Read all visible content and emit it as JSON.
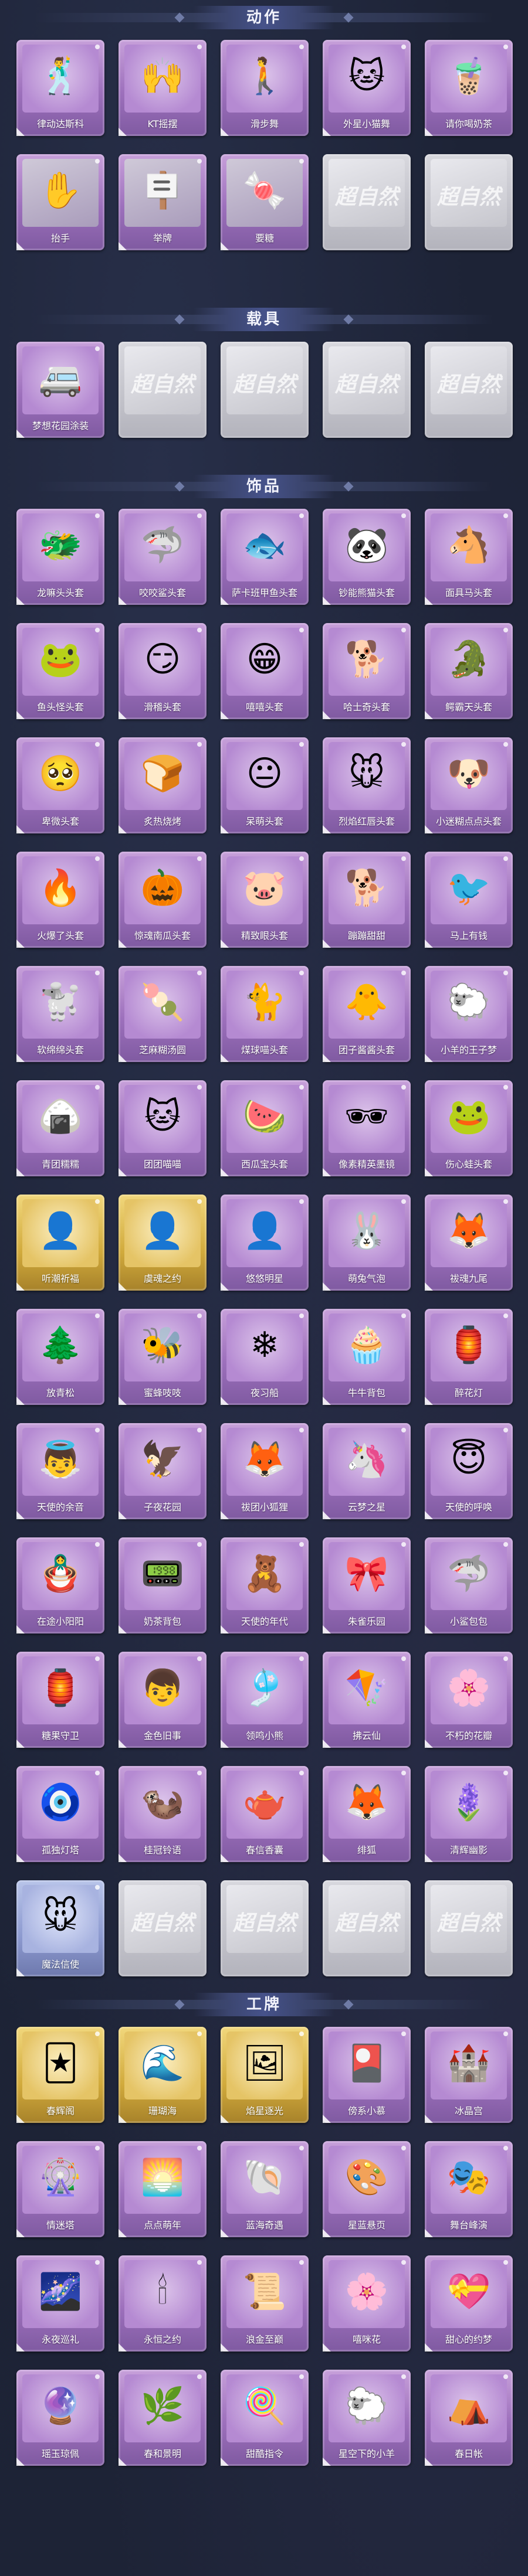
{
  "sections": [
    {
      "key": "actions",
      "title": "动作",
      "cards": [
        {
          "name": "律动达斯科",
          "icon": "🕺",
          "style": "purple"
        },
        {
          "name": "KT摇摆",
          "icon": "🙌",
          "style": "purple"
        },
        {
          "name": "滑步舞",
          "icon": "🚶",
          "style": "purple"
        },
        {
          "name": "外星小猫舞",
          "icon": "🐱",
          "style": "purple"
        },
        {
          "name": "请你喝奶茶",
          "icon": "🧋",
          "style": "purple"
        },
        {
          "name": "抬手",
          "icon": "✋",
          "style": "locked"
        },
        {
          "name": "举牌",
          "icon": "🪧",
          "style": "locked"
        },
        {
          "name": "要糖",
          "icon": "🍬",
          "style": "locked"
        },
        {
          "name": "",
          "icon": "",
          "style": "empty",
          "watermark": "超自然"
        },
        {
          "name": "",
          "icon": "",
          "style": "empty",
          "watermark": "超自然"
        }
      ]
    },
    {
      "key": "vehicles",
      "title": "载具",
      "cards": [
        {
          "name": "梦想花园涂装",
          "icon": "🚐",
          "style": "purple"
        },
        {
          "name": "",
          "icon": "",
          "style": "empty",
          "watermark": "超自然"
        },
        {
          "name": "",
          "icon": "",
          "style": "empty",
          "watermark": "超自然"
        },
        {
          "name": "",
          "icon": "",
          "style": "empty",
          "watermark": "超自然"
        },
        {
          "name": "",
          "icon": "",
          "style": "empty",
          "watermark": "超自然"
        }
      ]
    },
    {
      "key": "accessories",
      "title": "饰品",
      "cards": [
        {
          "name": "龙嘛头头套",
          "icon": "🐲",
          "style": "purple"
        },
        {
          "name": "咬咬鲨头套",
          "icon": "🦈",
          "style": "purple"
        },
        {
          "name": "萨卡班甲鱼头套",
          "icon": "🐟",
          "style": "purple"
        },
        {
          "name": "钞能熊猫头套",
          "icon": "🐼",
          "style": "purple"
        },
        {
          "name": "面具马头套",
          "icon": "🐴",
          "style": "purple"
        },
        {
          "name": "鱼头怪头套",
          "icon": "🐸",
          "style": "purple"
        },
        {
          "name": "滑稽头套",
          "icon": "😏",
          "style": "purple"
        },
        {
          "name": "嘻嘻头套",
          "icon": "😁",
          "style": "purple"
        },
        {
          "name": "哈士奇头套",
          "icon": "🐕",
          "style": "purple"
        },
        {
          "name": "鳄霸天头套",
          "icon": "🐊",
          "style": "purple"
        },
        {
          "name": "卑微头套",
          "icon": "🥺",
          "style": "purple"
        },
        {
          "name": "炙热烧烤",
          "icon": "🍞",
          "style": "purple"
        },
        {
          "name": "呆萌头套",
          "icon": "😐",
          "style": "purple"
        },
        {
          "name": "烈焰红唇头套",
          "icon": "🐭",
          "style": "purple"
        },
        {
          "name": "小迷糊点点头套",
          "icon": "🐶",
          "style": "purple"
        },
        {
          "name": "火爆了头套",
          "icon": "🔥",
          "style": "purple"
        },
        {
          "name": "惊魂南瓜头套",
          "icon": "🎃",
          "style": "purple"
        },
        {
          "name": "精致眼头套",
          "icon": "🐷",
          "style": "purple"
        },
        {
          "name": "蹦蹦甜甜",
          "icon": "🐕",
          "style": "purple"
        },
        {
          "name": "马上有钱",
          "icon": "🐦",
          "style": "purple"
        },
        {
          "name": "软绵绵头套",
          "icon": "🐩",
          "style": "purple"
        },
        {
          "name": "芝麻糊汤圆",
          "icon": "🍡",
          "style": "purple"
        },
        {
          "name": "煤球喵头套",
          "icon": "🐈",
          "style": "purple"
        },
        {
          "name": "团子酱酱头套",
          "icon": "🐥",
          "style": "purple"
        },
        {
          "name": "小羊的王子梦",
          "icon": "🐑",
          "style": "purple"
        },
        {
          "name": "青团糯糯",
          "icon": "🍙",
          "style": "purple"
        },
        {
          "name": "团团喵喵",
          "icon": "🐱",
          "style": "purple"
        },
        {
          "name": "西瓜宝头套",
          "icon": "🍉",
          "style": "purple"
        },
        {
          "name": "像素精英墨镜",
          "icon": "🕶",
          "style": "purple"
        },
        {
          "name": "伤心蛙头套",
          "icon": "🐸",
          "style": "purple"
        },
        {
          "name": "听潮祈福",
          "icon": "👤",
          "style": "gold"
        },
        {
          "name": "虞魂之约",
          "icon": "👤",
          "style": "gold"
        },
        {
          "name": "悠悠明星",
          "icon": "👤",
          "style": "purple"
        },
        {
          "name": "萌兔气泡",
          "icon": "🐰",
          "style": "purple"
        },
        {
          "name": "祓魂九尾",
          "icon": "🦊",
          "style": "purple"
        },
        {
          "name": "放青松",
          "icon": "🌲",
          "style": "purple"
        },
        {
          "name": "蜜蜂吱吱",
          "icon": "🐝",
          "style": "purple"
        },
        {
          "name": "夜习船",
          "icon": "❄",
          "style": "purple"
        },
        {
          "name": "牛牛背包",
          "icon": "🧁",
          "style": "purple"
        },
        {
          "name": "醉花灯",
          "icon": "🏮",
          "style": "purple"
        },
        {
          "name": "天使的余音",
          "icon": "👼",
          "style": "purple"
        },
        {
          "name": "子夜花园",
          "icon": "🦅",
          "style": "purple"
        },
        {
          "name": "祓团小狐狸",
          "icon": "🦊",
          "style": "purple"
        },
        {
          "name": "云梦之星",
          "icon": "🦄",
          "style": "purple"
        },
        {
          "name": "天使的呼唤",
          "icon": "😇",
          "style": "purple"
        },
        {
          "name": "在途小阳阳",
          "icon": "🪆",
          "style": "purple"
        },
        {
          "name": "奶茶背包",
          "icon": "📟",
          "style": "purple"
        },
        {
          "name": "天使的年代",
          "icon": "🧸",
          "style": "purple"
        },
        {
          "name": "朱雀乐园",
          "icon": "🎀",
          "style": "purple"
        },
        {
          "name": "小鲨包包",
          "icon": "🦈",
          "style": "purple"
        },
        {
          "name": "糖果守卫",
          "icon": "🏮",
          "style": "purple"
        },
        {
          "name": "金色旧事",
          "icon": "👦",
          "style": "purple"
        },
        {
          "name": "领鸣小熊",
          "icon": "🎐",
          "style": "purple"
        },
        {
          "name": "拂云仙",
          "icon": "🪁",
          "style": "purple"
        },
        {
          "name": "不朽的花瓣",
          "icon": "🌸",
          "style": "purple"
        },
        {
          "name": "孤独灯塔",
          "icon": "🧿",
          "style": "purple"
        },
        {
          "name": "桂冠铃语",
          "icon": "🦦",
          "style": "purple"
        },
        {
          "name": "春信香囊",
          "icon": "🫖",
          "style": "purple"
        },
        {
          "name": "绯狐",
          "icon": "🦊",
          "style": "purple"
        },
        {
          "name": "清辉幽影",
          "icon": "🪻",
          "style": "purple"
        },
        {
          "name": "魔法信使",
          "icon": "🐭",
          "style": "blue"
        },
        {
          "name": "",
          "icon": "",
          "style": "empty",
          "watermark": "超自然"
        },
        {
          "name": "",
          "icon": "",
          "style": "empty",
          "watermark": "超自然"
        },
        {
          "name": "",
          "icon": "",
          "style": "empty",
          "watermark": "超自然"
        },
        {
          "name": "",
          "icon": "",
          "style": "empty",
          "watermark": "超自然"
        }
      ]
    },
    {
      "key": "badges",
      "title": "工牌",
      "cards": [
        {
          "name": "春辉阁",
          "icon": "🃏",
          "style": "gold"
        },
        {
          "name": "珊瑚海",
          "icon": "🌊",
          "style": "gold"
        },
        {
          "name": "焰星逐光",
          "icon": "🖼",
          "style": "gold"
        },
        {
          "name": "傍系小慕",
          "icon": "🎴",
          "style": "purple"
        },
        {
          "name": "冰晶宫",
          "icon": "🏰",
          "style": "purple"
        },
        {
          "name": "情迷塔",
          "icon": "🎡",
          "style": "purple"
        },
        {
          "name": "点点萌年",
          "icon": "🌅",
          "style": "purple"
        },
        {
          "name": "蓝海奇遇",
          "icon": "🐚",
          "style": "purple"
        },
        {
          "name": "星蓝悬页",
          "icon": "🎨",
          "style": "purple"
        },
        {
          "name": "舞台峰演",
          "icon": "🎭",
          "style": "purple"
        },
        {
          "name": "永夜巡礼",
          "icon": "🌌",
          "style": "purple"
        },
        {
          "name": "永恒之约",
          "icon": "🕯",
          "style": "purple"
        },
        {
          "name": "浪金至巅",
          "icon": "📜",
          "style": "purple"
        },
        {
          "name": "嘻咪花",
          "icon": "🌸",
          "style": "purple"
        },
        {
          "name": "甜心的约梦",
          "icon": "💝",
          "style": "purple"
        },
        {
          "name": "瑶玉琼佩",
          "icon": "🔮",
          "style": "purple"
        },
        {
          "name": "春和景明",
          "icon": "🌿",
          "style": "purple"
        },
        {
          "name": "甜酷指令",
          "icon": "🍭",
          "style": "purple"
        },
        {
          "name": "星空下的小羊",
          "icon": "🐑",
          "style": "purple"
        },
        {
          "name": "春日帐",
          "icon": "⛺",
          "style": "purple"
        }
      ]
    }
  ]
}
